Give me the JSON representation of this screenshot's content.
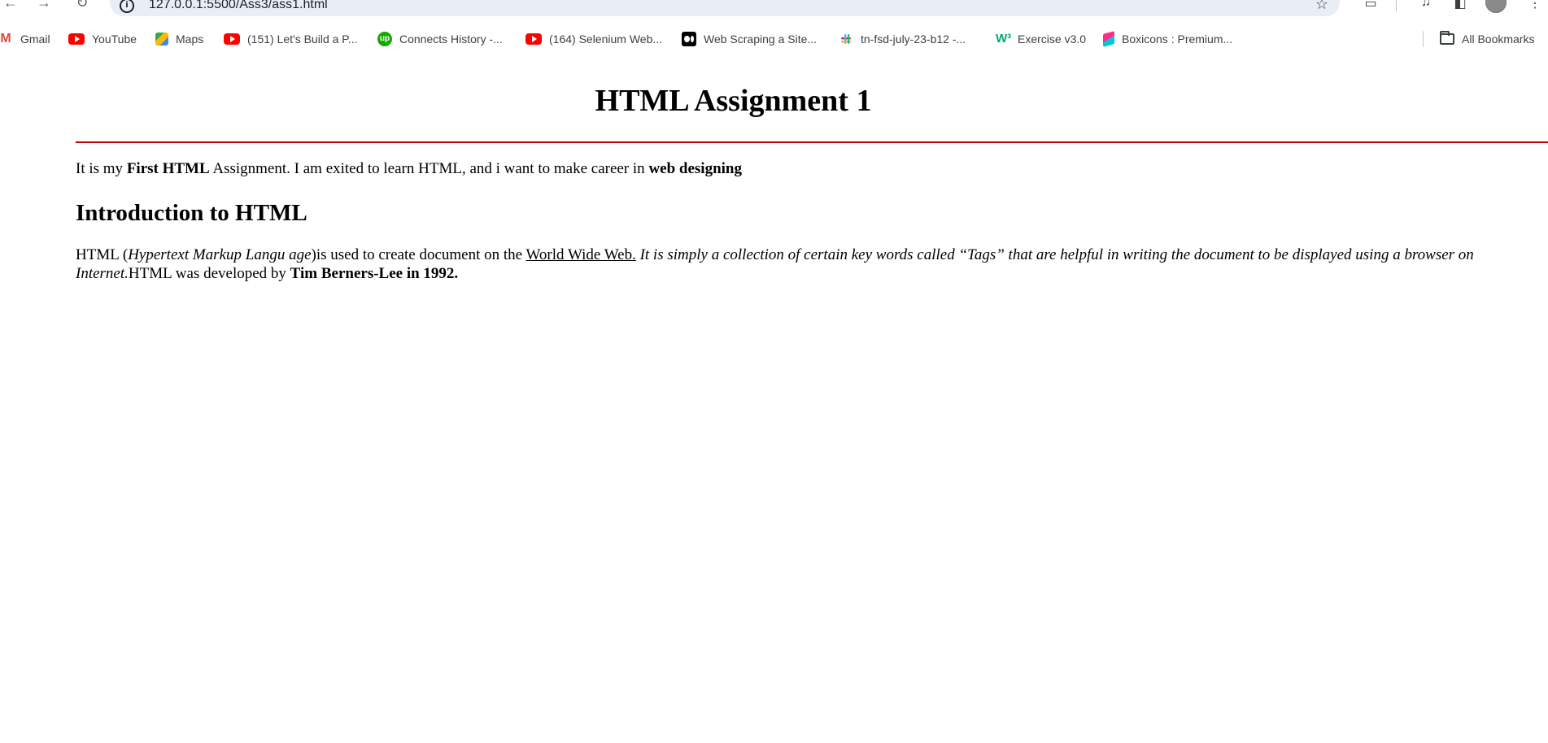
{
  "browser": {
    "url": "127.0.0.1:5500/Ass3/ass1.html",
    "back_icon": "arrow-left",
    "forward_icon": "arrow-right",
    "reload_icon": "reload"
  },
  "bookmarks": [
    {
      "label": "Gmail",
      "icon": "gmail-icon"
    },
    {
      "label": "YouTube",
      "icon": "youtube-icon"
    },
    {
      "label": "Maps",
      "icon": "maps-icon"
    },
    {
      "label": "(151) Let's Build a P...",
      "icon": "youtube-icon"
    },
    {
      "label": "Connects History -...",
      "icon": "upwork-icon"
    },
    {
      "label": "(164) Selenium Web...",
      "icon": "youtube-icon"
    },
    {
      "label": "Web Scraping a Site...",
      "icon": "medium-icon"
    },
    {
      "label": "tn-fsd-july-23-b12 -...",
      "icon": "slack-icon"
    },
    {
      "label": "Exercise v3.0",
      "icon": "w3schools-icon"
    },
    {
      "label": "Boxicons : Premium...",
      "icon": "boxicons-icon"
    }
  ],
  "all_bookmarks": "All Bookmarks",
  "page": {
    "title": "HTML Assignment 1",
    "rule_color": "#c00000",
    "intro": {
      "t1": "It is my ",
      "b1": "First HTML",
      "t2": " Assignment. I am exited to learn HTML, and i want to make career in ",
      "b2": "web designing"
    },
    "heading": "Introduction to HTML",
    "body": {
      "t1": "HTML (",
      "i1": "Hypertext Markup Langu age",
      "t2": ")is used to create document on the ",
      "link": "World Wide Web.",
      "t3": " ",
      "i2": "It is simply a collection of certain key words called “Tags” that are helpful in writing the document to be displayed using a browser on Internet.",
      "t4": "HTML was developed by ",
      "b1": "Tim Berners-Lee in 1992."
    }
  }
}
